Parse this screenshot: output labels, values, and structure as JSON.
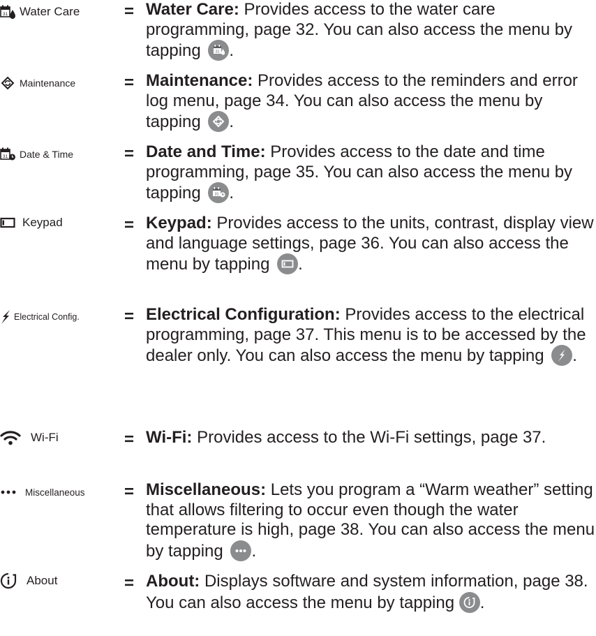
{
  "entries": [
    {
      "label": "Water Care",
      "icon": "calendar-drop-icon",
      "term": "Water Care:",
      "desc": "Provides access to the water care programming, page 32. You can also access the menu by tapping",
      "end": "."
    },
    {
      "label": "Maintenance",
      "icon": "maintenance-icon",
      "term": "Maintenance:",
      "desc": "Provides access to the reminders and error log menu, page 34. You can also access the menu by tapping",
      "end": "."
    },
    {
      "label": "Date & Time",
      "icon": "calendar-clock-icon",
      "term": "Date and Time:",
      "desc": "Provides access to the date and time programming, page 35. You can also access the menu by tapping",
      "end": "."
    },
    {
      "label": "Keypad",
      "icon": "keypad-icon",
      "term": "Keypad:",
      "desc": "Provides access to the units, contrast, display view and language settings, page 36. You can also access the menu by tapping",
      "end": "."
    },
    {
      "label": "Electrical Config.",
      "icon": "lightning-icon",
      "term": "Electrical Configuration:",
      "desc": "Provides access to the electrical programming, page 37. This menu is to be accessed by the dealer only. You can also access the menu by tapping",
      "end": "."
    },
    {
      "label": "Wi-Fi",
      "icon": "wifi-icon",
      "term": "Wi-Fi:",
      "desc": "Provides access to the Wi-Fi settings, page 37.",
      "end": ""
    },
    {
      "label": "Miscellaneous",
      "icon": "ellipsis-icon",
      "term": "Miscellaneous:",
      "desc": "Lets you program a “Warm weather” setting that allows filtering to occur even though the water temperature is high, page 38. You can also access the menu by tapping",
      "end": "."
    },
    {
      "label": "About",
      "icon": "info-icon",
      "term": "About:",
      "desc": "Displays software and system information, page 38. You can also access the menu by tapping",
      "end": "."
    }
  ],
  "separator": "=",
  "icon_calendar_number": "31",
  "colors": {
    "text": "#231f20",
    "icon_circle": "#8a8c8e"
  }
}
